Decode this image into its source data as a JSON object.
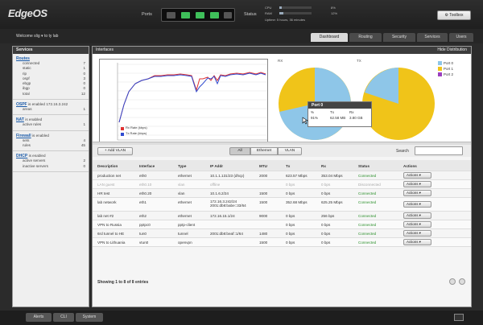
{
  "header": {
    "logo": "EdgeOS",
    "ports_label": "Ports",
    "status_label": "Status",
    "cpu_label": "CPU",
    "cpu_value": "8%",
    "cpu_fraction": 0.08,
    "ram_label": "RAM",
    "ram_value": "12%",
    "ram_fraction": 0.12,
    "uptime": "Uptime: 5 hours, 36 minutes",
    "toolbox_label": "Toolbox"
  },
  "subbar": {
    "welcome": "Welcome slig",
    "user_menu": "to ty lab",
    "tabs": [
      "Dashboard",
      "Routing",
      "Security",
      "Services",
      "Users"
    ],
    "active_tab": "Dashboard"
  },
  "sidebar": {
    "title": "Services",
    "routes": {
      "label": "Routes",
      "rows": [
        {
          "k": "connected",
          "v": "7"
        },
        {
          "k": "static",
          "v": "1"
        },
        {
          "k": "rip",
          "v": "0"
        },
        {
          "k": "ospf",
          "v": "3"
        },
        {
          "k": "ebgp",
          "v": "0"
        },
        {
          "k": "ibgp",
          "v": "0"
        },
        {
          "k": "total",
          "v": "12"
        }
      ]
    },
    "ospf": {
      "label": "OSPF",
      "text": "is enabled",
      "value": "172.16.3.242",
      "rows": [
        {
          "k": "areas",
          "v": "1"
        }
      ]
    },
    "nat": {
      "label": "NAT",
      "text": "is enabled",
      "rows": [
        {
          "k": "active rules",
          "v": "1"
        }
      ]
    },
    "firewall": {
      "label": "Firewall",
      "text": "is enabled",
      "rows": [
        {
          "k": "sets",
          "v": "4"
        },
        {
          "k": "rules",
          "v": "45"
        }
      ]
    },
    "dhcp": {
      "label": "DHCP",
      "text": "is enabled",
      "rows": [
        {
          "k": "active servers",
          "v": "2"
        },
        {
          "k": "inactive servers",
          "v": "0"
        }
      ]
    }
  },
  "main": {
    "title": "Interfaces",
    "hide_distribution": "Hide Distribution",
    "rx_label": "RX",
    "tx_label": "TX",
    "legend": [
      {
        "name": "Port 0",
        "color": "#8ec6e8"
      },
      {
        "name": "Port 1",
        "color": "#f0c419"
      },
      {
        "name": "Port 2",
        "color": "#9b3fbf"
      }
    ],
    "chart_legend": [
      {
        "name": "Rx Rate (kbps)",
        "color": "#e03131"
      },
      {
        "name": "Tx Rate (kbps)",
        "color": "#2f4ad0"
      }
    ],
    "tooltip": {
      "title": "Port 0",
      "headers": [
        "%",
        "Tx",
        "Rx"
      ],
      "values": [
        "91%",
        "62.58 MB",
        "3.80 GB"
      ]
    }
  },
  "toolbar": {
    "add_vlan": "+ Add VLAN",
    "filters": [
      "All",
      "Ethernet",
      "VLAN"
    ],
    "active_filter": "All",
    "search_label": "Search"
  },
  "table": {
    "headers": [
      "Description",
      "Interface",
      "Type",
      "IP Addr",
      "MTU",
      "Tx",
      "Rx",
      "Status",
      "Actions"
    ],
    "rows": [
      {
        "d": "production net",
        "i": "eth0",
        "t": "ethernet",
        "ip": "10.1.1.131/23 (dhcp)",
        "mtu": "2000",
        "tx": "623.57 Mbps",
        "rx": "353.04 Mbps",
        "status": "Connected",
        "s": "green",
        "a": "Actions"
      },
      {
        "d": "LAN guest",
        "i": "eth0.10",
        "t": "vlan",
        "ip": "offline",
        "mtu": "",
        "tx": "0 bps",
        "rx": "0 bps",
        "status": "Disconnected",
        "s": "orange",
        "a": "Actions",
        "grey": true
      },
      {
        "d": "HR test",
        "i": "eth0.20",
        "t": "vlan",
        "ip": "10.1.6.2/24",
        "mtu": "1500",
        "tx": "0 bps",
        "rx": "0 bps",
        "status": "Connected",
        "s": "green",
        "a": "Actions"
      },
      {
        "d": "lab network",
        "i": "eth1",
        "t": "ethernet",
        "ip": "172.16.3.242/24\n2001:db8:babe::33/64",
        "mtu": "1500",
        "tx": "352.68 Mbps",
        "rx": "625.25 Mbps",
        "status": "Connected",
        "s": "green",
        "a": "Actions",
        "tall": true
      },
      {
        "d": "lab net #2",
        "i": "eth2",
        "t": "ethernet",
        "ip": "172.16.15.1/24",
        "mtu": "9000",
        "tx": "0 bps",
        "rx": "256 bps",
        "status": "Connected",
        "s": "green",
        "a": "Actions"
      },
      {
        "d": "VPN to Russia",
        "i": "pptpc0",
        "t": "pptp-client",
        "ip": "",
        "mtu": "",
        "tx": "0 bps",
        "rx": "0 bps",
        "status": "Connected",
        "s": "green",
        "a": "Actions"
      },
      {
        "d": "6rd tunnel to HE",
        "i": "tun0",
        "t": "tunnel",
        "ip": "2001:db8:beaf::1/64",
        "mtu": "1480",
        "tx": "0 bps",
        "rx": "0 bps",
        "status": "Connected",
        "s": "green",
        "a": "Actions"
      },
      {
        "d": "VPN to Lithuania",
        "i": "vtun0",
        "t": "openvpn",
        "ip": "",
        "mtu": "1500",
        "tx": "0 bps",
        "rx": "0 bps",
        "status": "Connected",
        "s": "green",
        "a": "Actions"
      }
    ],
    "showing": "Showing 1 to 8 of 8 entries"
  },
  "bottombar": {
    "tabs": [
      "Alerts",
      "CLI",
      "System"
    ]
  }
}
